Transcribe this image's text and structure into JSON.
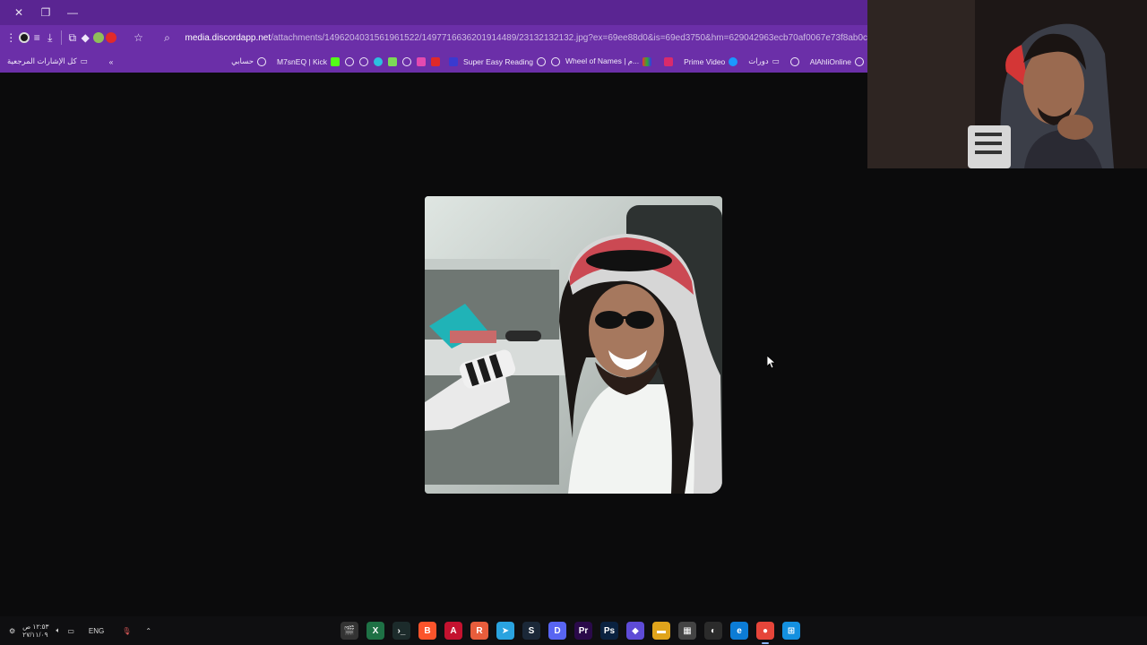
{
  "browser": {
    "url_host": "media.discordapp.net",
    "url_path": "/attachments/1496204031561961522/1497716636201914489/23132132132.jpg?ex=69ee88d0&is=69ed3750&hm=629042963ecb70af0067e73f8ab0c",
    "bookmarks_all_label": "كل الإشارات المرجعية",
    "bookmarks_overflow": "«",
    "bookmarks": [
      {
        "label": "حسابي"
      },
      {
        "label": "M7snEQ | Kick"
      },
      {
        "label": "Super Easy Reading"
      },
      {
        "label": "Wheel of Names | م..."
      },
      {
        "label": "Prime Video"
      },
      {
        "label": "دورات"
      },
      {
        "label": "AlAhliOnline"
      }
    ]
  },
  "taskbar": {
    "time": "١٢:٥٣ ص",
    "date": "٢٧/١١/٠٩",
    "language": "ENG",
    "apps": [
      {
        "name": "clapper",
        "glyph": "🎬",
        "color": "#333"
      },
      {
        "name": "excel",
        "glyph": "X",
        "color": "#1e7145"
      },
      {
        "name": "terminal",
        "glyph": "›_",
        "color": "#1c2b2b"
      },
      {
        "name": "brave",
        "glyph": "B",
        "color": "#fb542b"
      },
      {
        "name": "autodesk",
        "glyph": "A",
        "color": "#c4122f"
      },
      {
        "name": "app-r",
        "glyph": "R",
        "color": "#e85d3c"
      },
      {
        "name": "telegram",
        "glyph": "➤",
        "color": "#2aa3df"
      },
      {
        "name": "steam",
        "glyph": "S",
        "color": "#1b2838"
      },
      {
        "name": "discord",
        "glyph": "D",
        "color": "#5865f2"
      },
      {
        "name": "premiere",
        "glyph": "Pr",
        "color": "#2a0a4a"
      },
      {
        "name": "photoshop",
        "glyph": "Ps",
        "color": "#0a2240"
      },
      {
        "name": "linear",
        "glyph": "◆",
        "color": "#5e4bd6"
      },
      {
        "name": "file-explorer",
        "glyph": "▬",
        "color": "#e0a41c"
      },
      {
        "name": "store",
        "glyph": "▦",
        "color": "#444"
      },
      {
        "name": "obs",
        "glyph": "◐",
        "color": "#2b2b2b"
      },
      {
        "name": "edge",
        "glyph": "e",
        "color": "#0c7cd5"
      },
      {
        "name": "chrome",
        "glyph": "●",
        "color": "#e6453a"
      },
      {
        "name": "windows-start",
        "glyph": "⊞",
        "color": "#1490df"
      }
    ]
  }
}
